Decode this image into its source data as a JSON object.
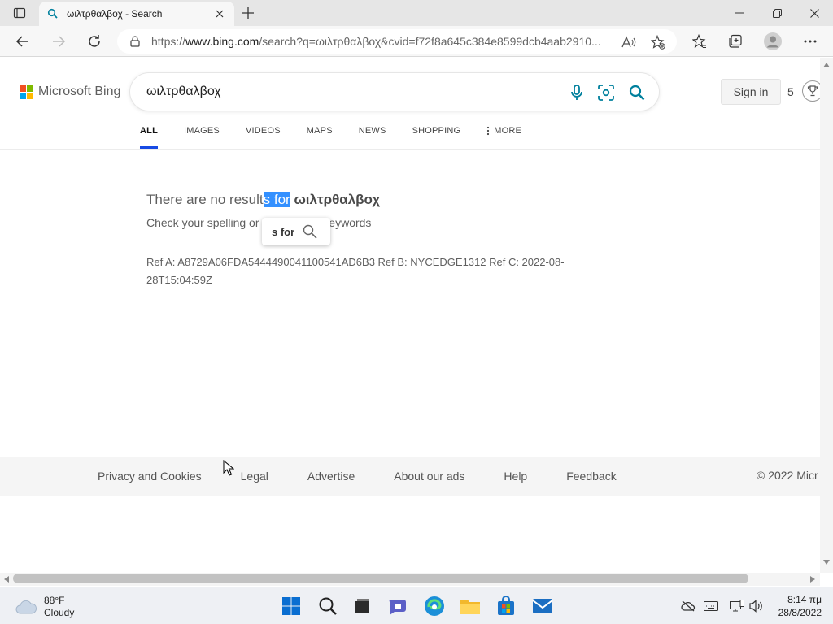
{
  "browser": {
    "tab_title": "ωιλτρθαλβοχ - Search",
    "url_prefix": "https://",
    "url_host": "www.bing.com",
    "url_rest": "/search?q=ωιλτρθαλβοχ&cvid=f72f8a645c384e8599dcb4aab2910..."
  },
  "bing": {
    "logo_text": "Microsoft Bing",
    "search_value": "ωιλτρθαλβοχ",
    "signin_label": "Sign in",
    "rewards_count": "5",
    "nav_tabs": [
      "ALL",
      "IMAGES",
      "VIDEOS",
      "MAPS",
      "NEWS",
      "SHOPPING",
      "MORE"
    ],
    "no_results_prefix": "There are no result",
    "no_results_highlight": "s for",
    "no_results_query": "ωιλτρθαλβοχ",
    "hint_start": "Check your spelling or t",
    "hint_end": "eywords",
    "popup_label": "s for",
    "ref_line": "Ref A: A8729A06FDA5444490041100541AD6B3 Ref B: NYCEDGE1312 Ref C: 2022-08-28T15:04:59Z",
    "footer_links": [
      "Privacy and Cookies",
      "Legal",
      "Advertise",
      "About our ads",
      "Help",
      "Feedback"
    ],
    "copyright": "© 2022 Micr"
  },
  "taskbar": {
    "temperature": "88°F",
    "condition": "Cloudy",
    "time": "8:14 πμ",
    "date": "28/8/2022"
  },
  "colors": {
    "accent_blue": "#174ae4",
    "selection": "#3390ff",
    "ms_red": "#f25022",
    "ms_green": "#7fba00",
    "ms_blue": "#00a4ef",
    "ms_yellow": "#ffb900",
    "bing_teal": "#00809d"
  }
}
